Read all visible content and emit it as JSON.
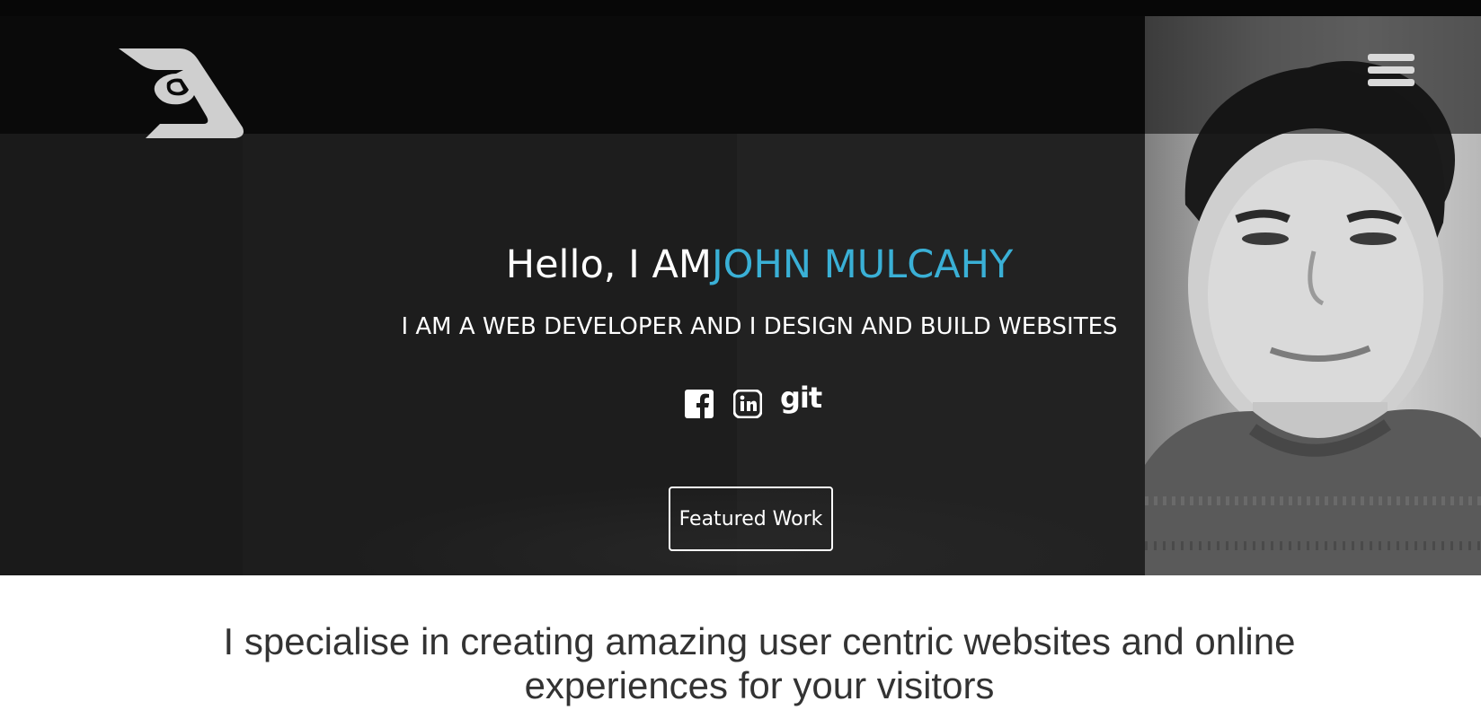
{
  "nav": {
    "logo_icon": "stylized-shield-logo-icon",
    "menu_icon": "hamburger-menu-icon"
  },
  "hero": {
    "greeting": "Hello, I AM",
    "name": "JOHN MULCAHY",
    "tagline": "I AM A WEB DEVELOPER AND I DESIGN AND BUILD WEBSITES",
    "social": {
      "facebook_icon": "facebook-icon",
      "linkedin_icon": "linkedin-icon",
      "git_label": "git"
    },
    "cta_label": "Featured Work"
  },
  "intro": {
    "text": "I specialise in creating amazing user centric websites and online experiences for your visitors"
  },
  "colors": {
    "accent": "#3ab0d6",
    "hero_bg": "#1d1d1d",
    "navbar_bg": "#0a0a0a",
    "text_dark": "#333333"
  }
}
